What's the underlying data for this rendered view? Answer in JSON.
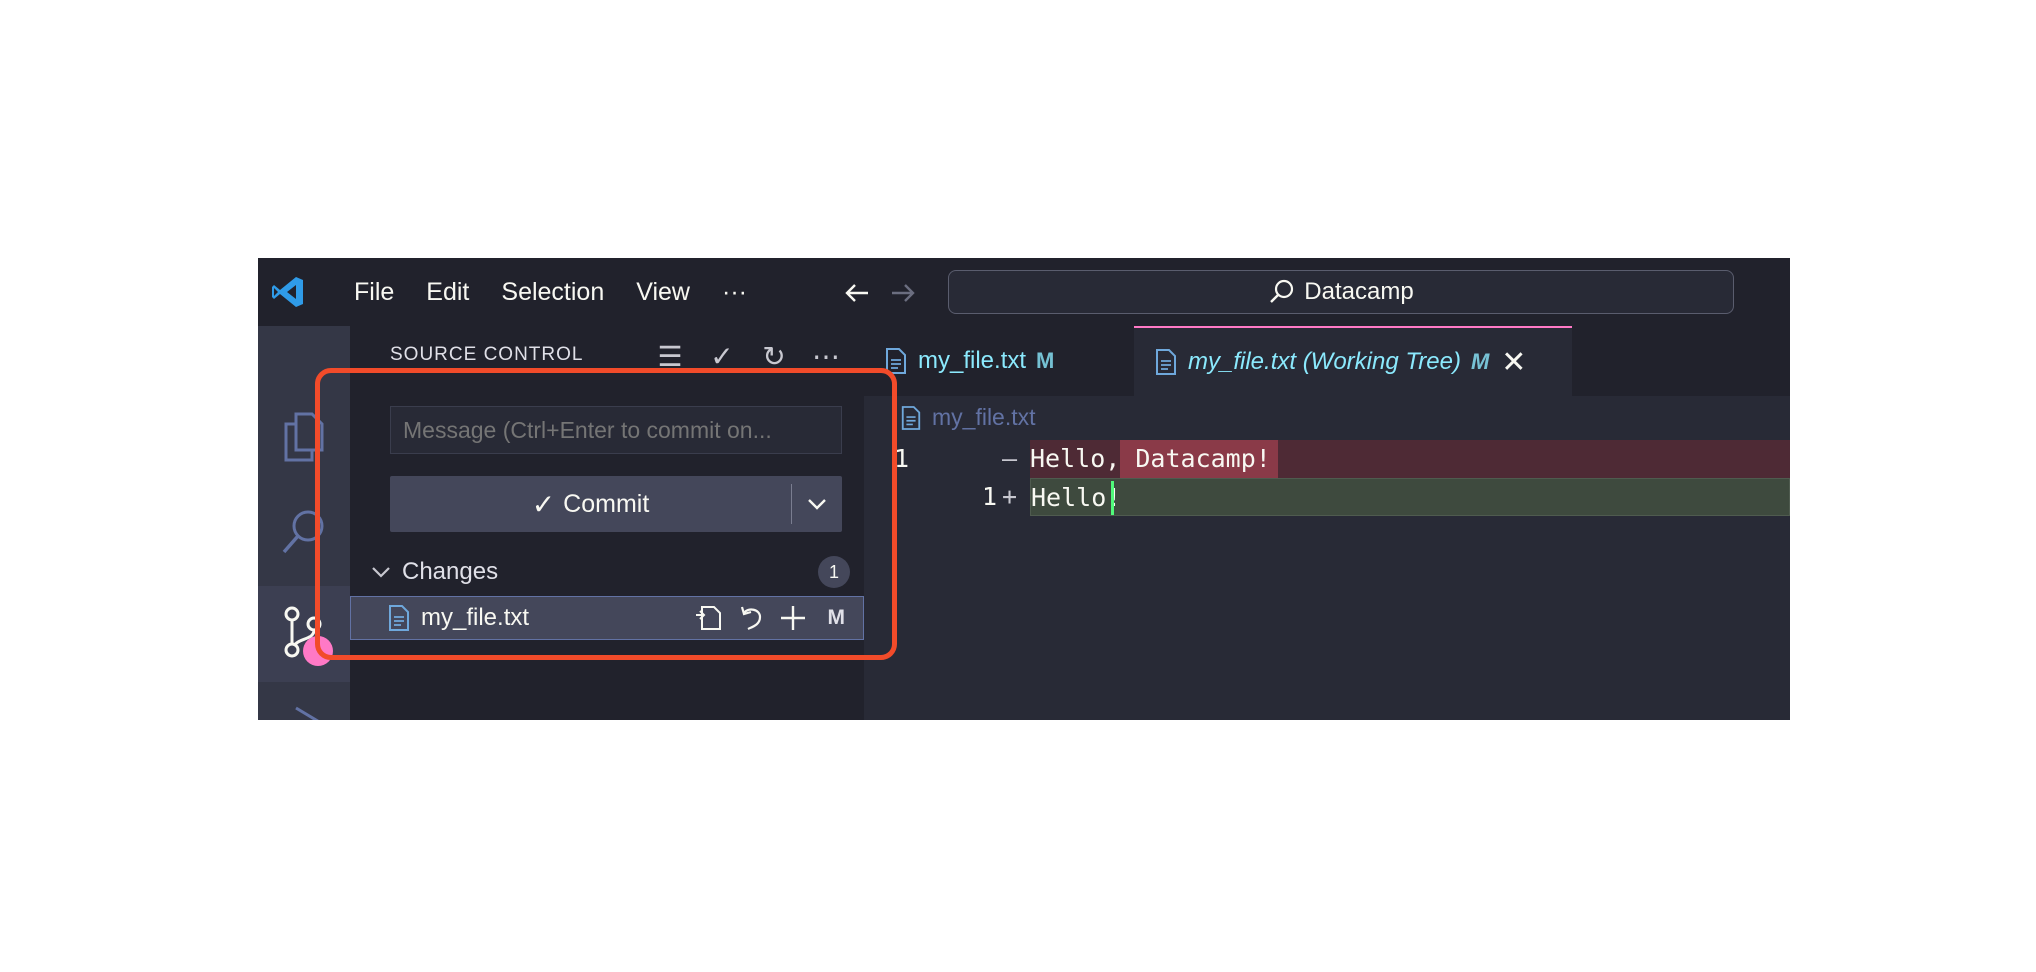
{
  "titlebar": {
    "menu": [
      "File",
      "Edit",
      "Selection",
      "View",
      "···"
    ],
    "search_text": "Datacamp"
  },
  "activity_bar": {
    "icons": [
      "explorer-icon",
      "search-icon",
      "source-control-icon",
      "run-debug-icon"
    ],
    "badge_color": "#ff79c6"
  },
  "sidebar": {
    "title": "SOURCE CONTROL",
    "message_placeholder": "Message (Ctrl+Enter to commit on...",
    "commit_label": "Commit",
    "changes_label": "Changes",
    "changes_count": "1",
    "file": {
      "name": "my_file.txt",
      "status": "M"
    }
  },
  "editor": {
    "tabs": [
      {
        "label": "my_file.txt",
        "status": "M"
      },
      {
        "label": "my_file.txt (Working Tree)",
        "status": "M"
      }
    ],
    "breadcrumb": "my_file.txt",
    "diff": {
      "removed": {
        "line_number": "1",
        "sign": "—",
        "text": "Hello, Datacamp!"
      },
      "added": {
        "line_number": "1",
        "sign": "+",
        "text": "Hello!"
      }
    }
  },
  "colors": {
    "highlight_border": "#f24b2a",
    "tab_text": "#8be9fd",
    "deleted_line": "#4e2a35",
    "added_line": "#3e4a3e"
  }
}
